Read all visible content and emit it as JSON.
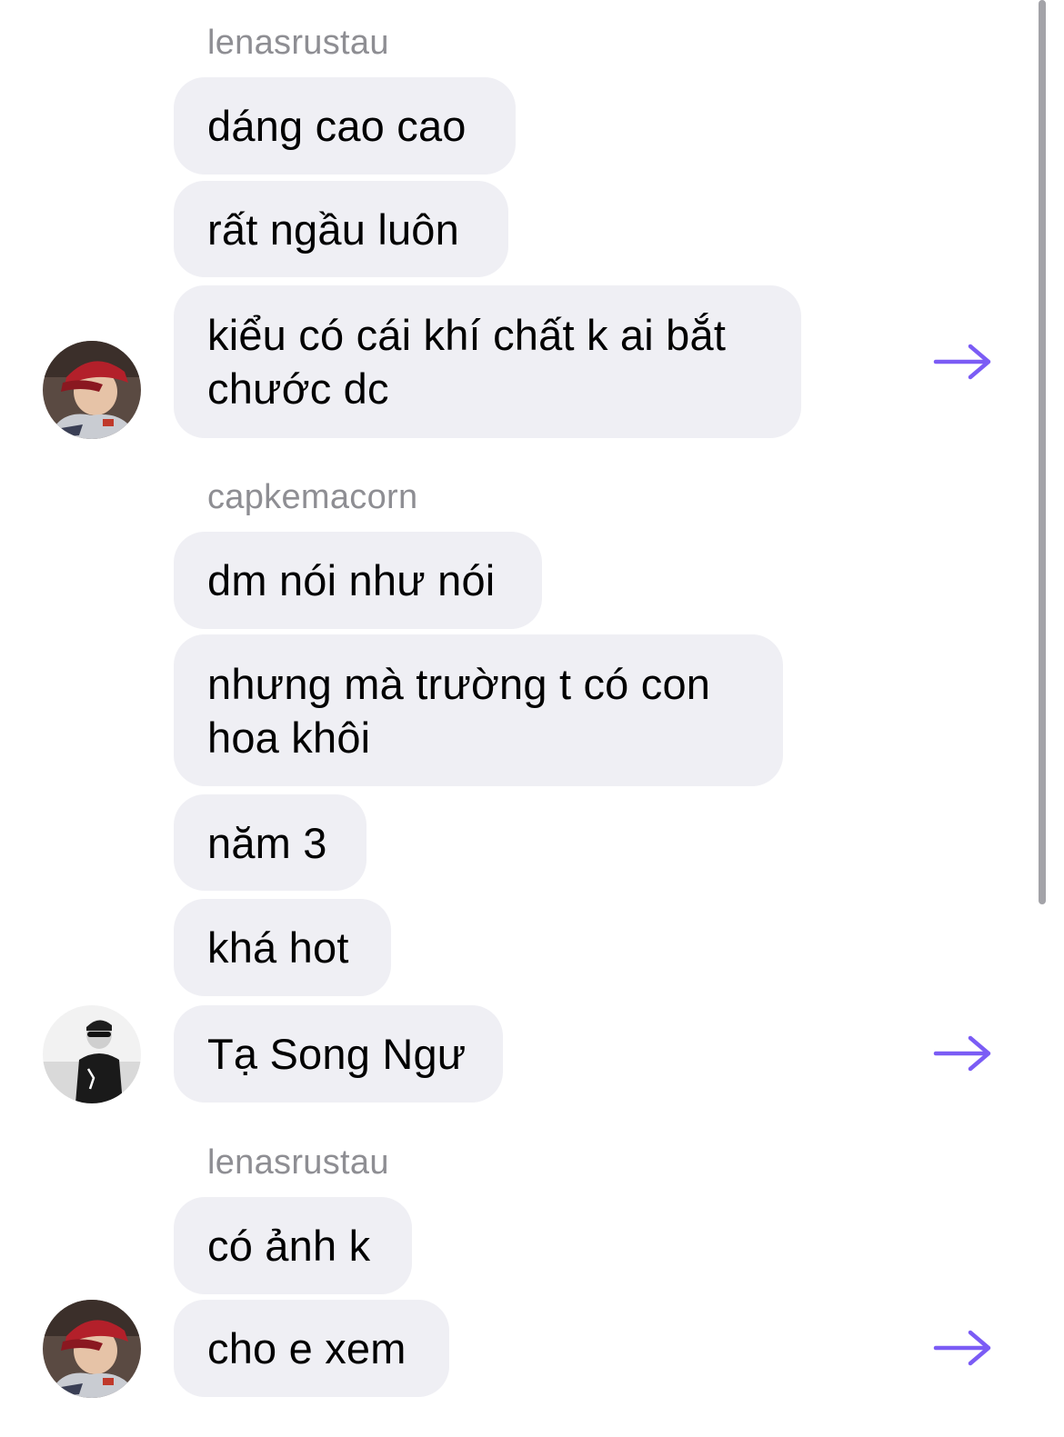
{
  "accent_color": "#7b5cf5",
  "groups": [
    {
      "sender": "lenasrustau",
      "avatar_icon": "user-photo-red-cap",
      "messages": [
        "dáng cao cao",
        "rất ngầu luôn",
        "kiểu có cái khí chất k ai bắt chước dc"
      ],
      "share_icon": "arrow-right-icon"
    },
    {
      "sender": "capkemacorn",
      "avatar_icon": "user-photo-sunglasses",
      "messages": [
        "dm nói như nói",
        "nhưng mà trường t có con hoa khôi",
        "năm 3",
        "khá hot",
        "Tạ Song Ngư"
      ],
      "share_icon": "arrow-right-icon"
    },
    {
      "sender": "lenasrustau",
      "avatar_icon": "user-photo-red-cap",
      "messages": [
        "có ảnh k",
        "cho e xem"
      ],
      "share_icon": "arrow-right-icon"
    }
  ]
}
